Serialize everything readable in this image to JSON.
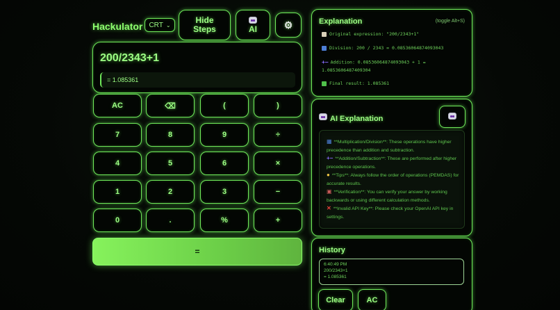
{
  "header": {
    "title": "Hackulator",
    "mode_value": "CRT",
    "hide_steps_line1": "Hide",
    "hide_steps_line2": "Steps",
    "ai_label": "AI",
    "settings_icon": "gear-icon"
  },
  "display": {
    "expression": "200/2343+1",
    "result": "= 1.085361"
  },
  "keypad": {
    "rows": [
      [
        "AC",
        "⌫",
        "(",
        ")"
      ],
      [
        "7",
        "8",
        "9",
        "÷"
      ],
      [
        "4",
        "5",
        "6",
        "×"
      ],
      [
        "1",
        "2",
        "3",
        "−"
      ],
      [
        "0",
        ".",
        "%",
        "+"
      ]
    ],
    "equals": "="
  },
  "explanation": {
    "title": "Explanation",
    "toggle_hint": "(toggle Alt+S)",
    "steps": [
      "Original expression: \"200/2343+1\"",
      "Division: 200 / 2343 = 0.08536064874093043",
      "Addition: 0.08536064874093043 + 1 = 1.0853606487409304",
      "Final result: 1.085361"
    ]
  },
  "ai_explanation": {
    "title": "AI Explanation",
    "items": [
      "**Multiplication/Division**: These operations have higher precedence than addition and subtraction.",
      "**Addition/Subtraction**: These are performed after higher precedence operations.",
      "**Tips**: Always follow the order of operations (PEMDAS) for accurate results.",
      "**Verification**: You can verify your answer by working backwards or using different calculation methods.",
      "**Invalid API Key**: Please check your OpenAI API key in settings."
    ]
  },
  "history": {
    "title": "History",
    "entry_time": "6:40:49 PM",
    "entry_expression": "200/2343+1",
    "entry_result": "= 1.085361",
    "clear_label": "Clear",
    "ac_label": "AC"
  },
  "colors": {
    "accent": "#6fe85a",
    "background": "#050805",
    "equals_bg": "#7ae052"
  }
}
